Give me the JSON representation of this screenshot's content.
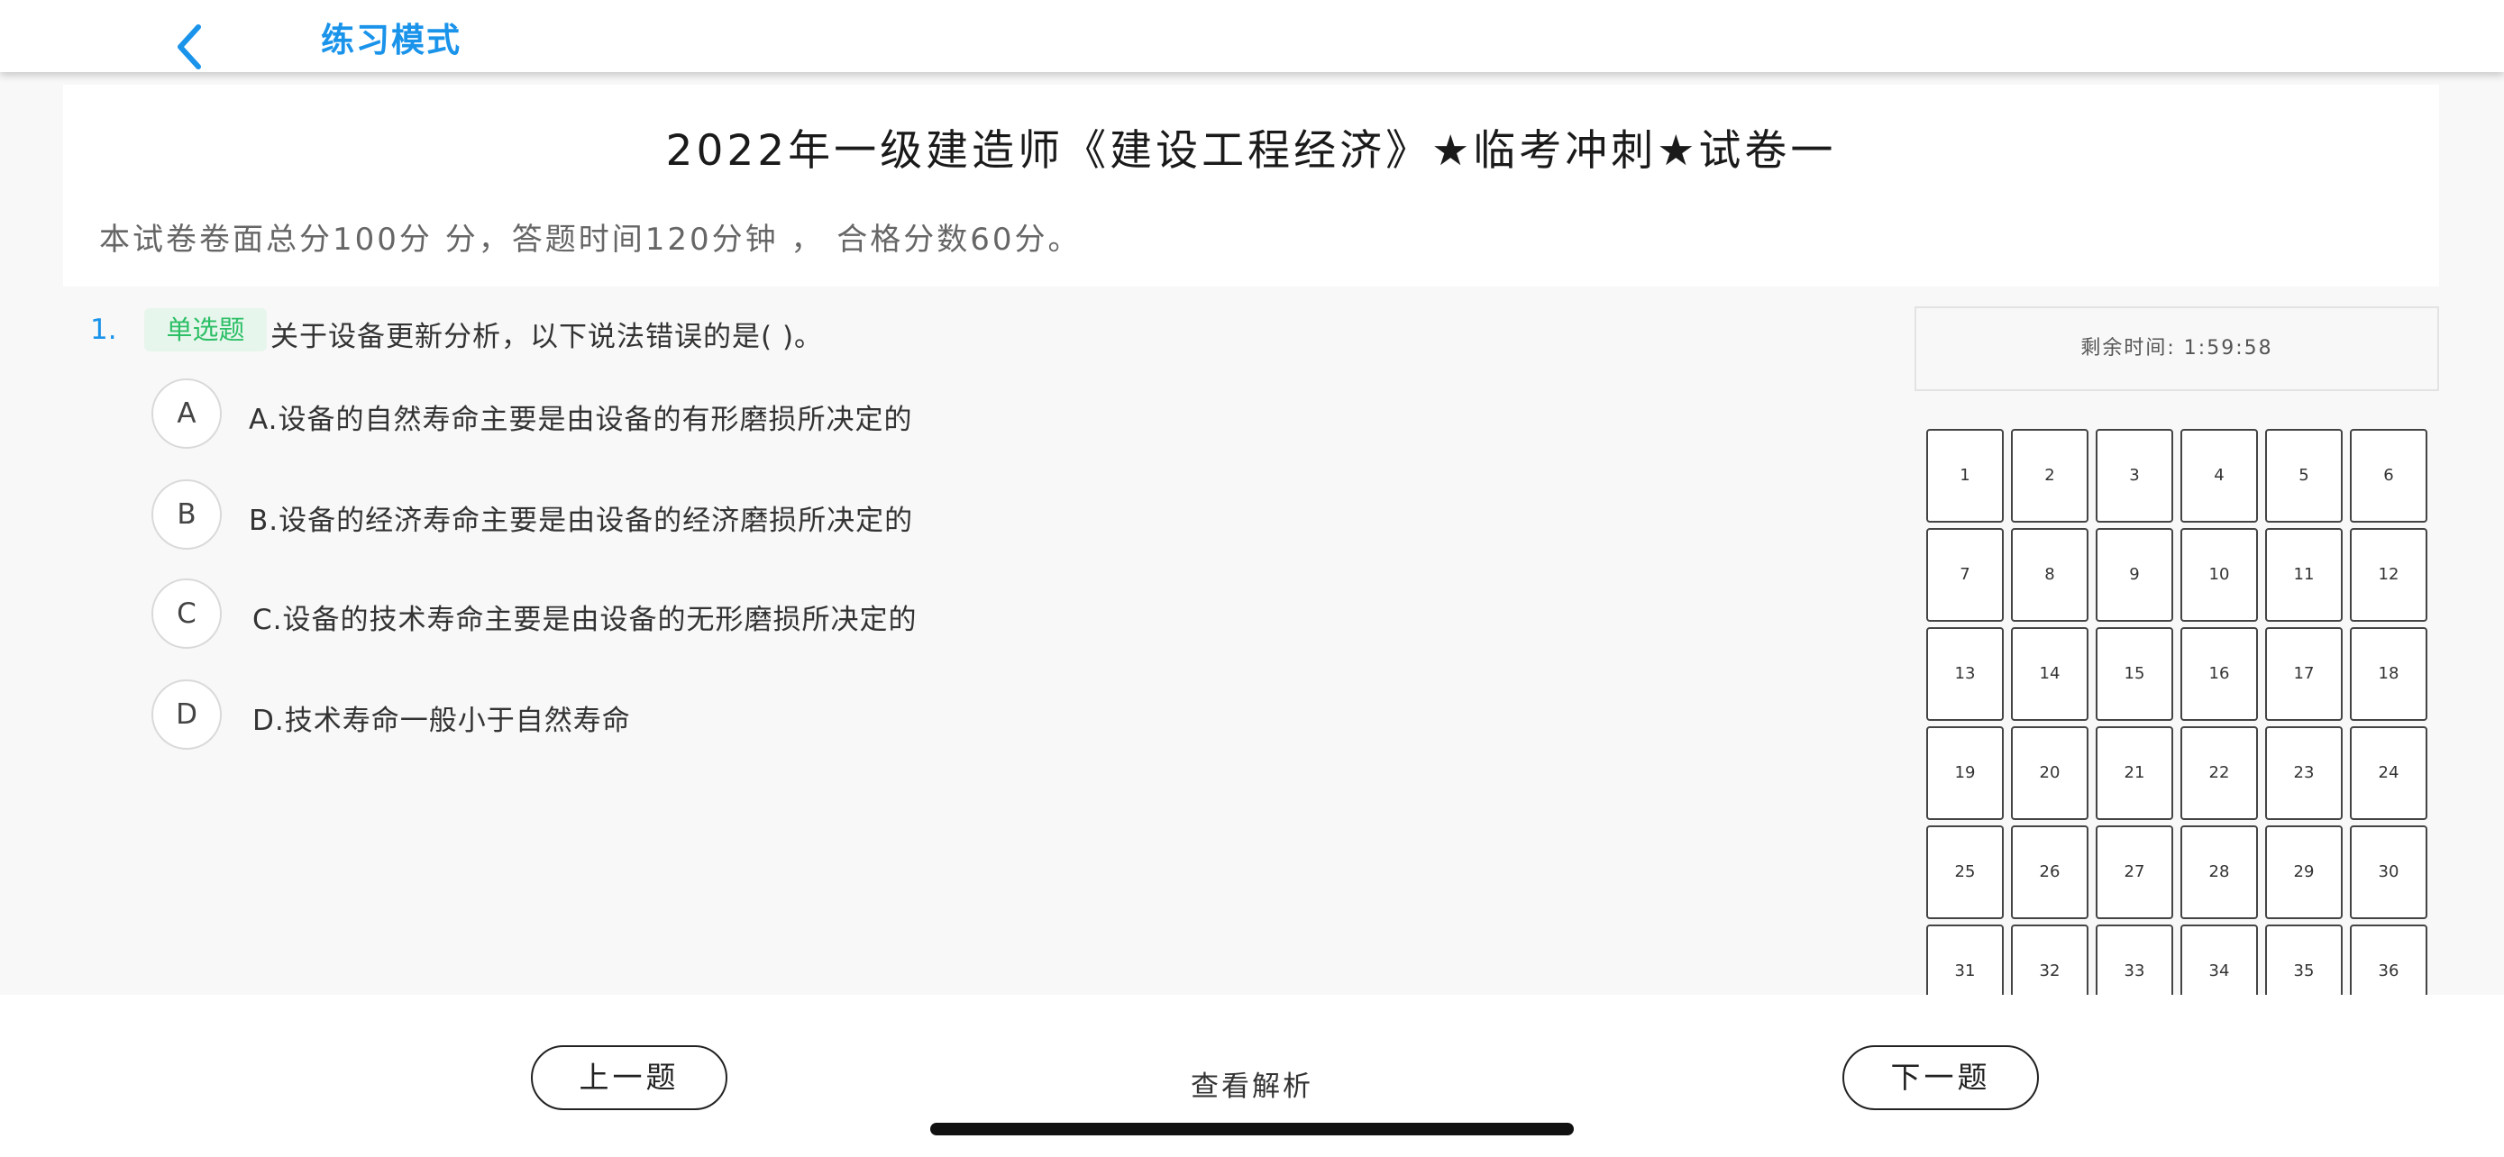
{
  "header": {
    "title": "练习模式"
  },
  "exam": {
    "title": "2022年一级建造师《建设工程经济》★临考冲刺★试卷一",
    "description": "本试卷卷面总分100分 分，答题时间120分钟 ， 合格分数60分。"
  },
  "question": {
    "number": "1.",
    "type": "单选题",
    "text": "关于设备更新分析，以下说法错误的是(    )。",
    "options": [
      {
        "letter": "A",
        "text": "A.设备的自然寿命主要是由设备的有形磨损所决定的"
      },
      {
        "letter": "B",
        "text": "B.设备的经济寿命主要是由设备的经济磨损所决定的"
      },
      {
        "letter": "C",
        "text": "C.设备的技术寿命主要是由设备的无形磨损所决定的"
      },
      {
        "letter": "D",
        "text": "D.技术寿命一般小于自然寿命"
      }
    ]
  },
  "timer": {
    "text": "剩余时间: 1:59:58"
  },
  "answer_card": {
    "cells": [
      "1",
      "2",
      "3",
      "4",
      "5",
      "6",
      "7",
      "8",
      "9",
      "10",
      "11",
      "12",
      "13",
      "14",
      "15",
      "16",
      "17",
      "18",
      "19",
      "20",
      "21",
      "22",
      "23",
      "24",
      "25",
      "26",
      "27",
      "28",
      "29",
      "30",
      "31",
      "32",
      "33",
      "34",
      "35",
      "36"
    ]
  },
  "bottom": {
    "prev_label": "上一题",
    "analysis_label": "查看解析",
    "next_label": "下一题"
  },
  "colors": {
    "accent": "#1a93ea",
    "tag_bg": "#e7f6ec",
    "tag_text": "#2cbf66"
  },
  "icons": {
    "back": "chevron-left-icon"
  }
}
